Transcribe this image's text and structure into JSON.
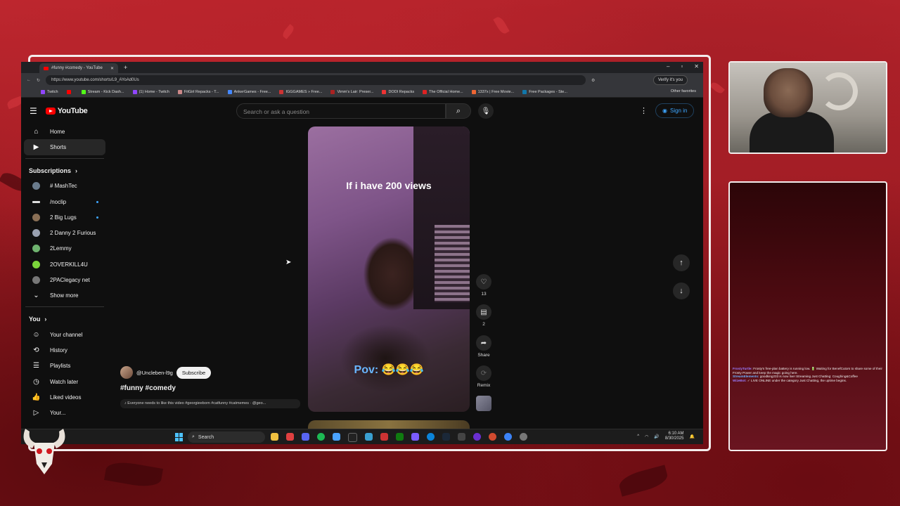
{
  "browser": {
    "tab_title": "#funny #comedy - YouTube",
    "url": "https://www.youtube.com/shorts/L9_AYoAd0Us",
    "verify_label": "Verify it's you",
    "bookmarks": [
      "Twitch",
      "",
      "Stream - Kick Dash...",
      "(1) Home - Twitch",
      "FitGirl Repacks - T...",
      "AnkerGames - Free...",
      "IGGGAMES » Free...",
      "Vimm's Lair: Preser...",
      "DODI Repacks",
      "The Official Home...",
      "1337x | Free Movie...",
      "Free Packages - Ste..."
    ],
    "other_favorites": "Other favorites"
  },
  "youtube": {
    "logo_text": "YouTube",
    "search_placeholder": "Search or ask a question",
    "sign_in": "Sign in",
    "nav": [
      {
        "label": "Home",
        "icon": "home-icon"
      },
      {
        "label": "Shorts",
        "icon": "shorts-icon"
      }
    ],
    "subscriptions_heading": "Subscriptions",
    "subscriptions": [
      {
        "label": "# MashTec",
        "color": "#6a7b8c",
        "live": false
      },
      {
        "label": "/noclip",
        "color": "#dddddd",
        "live": true
      },
      {
        "label": "2 Big Lugs",
        "color": "#8a6f55",
        "live": true
      },
      {
        "label": "2 Danny 2 Furious",
        "color": "#99a0b0",
        "live": false
      },
      {
        "label": "2Lemmy",
        "color": "#6fb36f",
        "live": false
      },
      {
        "label": "2OVERKILL4U",
        "color": "#7bd43a",
        "live": false
      },
      {
        "label": "2PAClegacy net",
        "color": "#777777",
        "live": false
      }
    ],
    "show_more": "Show more",
    "you_heading": "You",
    "you_items": [
      {
        "label": "Your channel",
        "icon": "person-icon"
      },
      {
        "label": "History",
        "icon": "history-icon"
      },
      {
        "label": "Playlists",
        "icon": "playlists-icon"
      },
      {
        "label": "Watch later",
        "icon": "clock-icon"
      },
      {
        "label": "Liked videos",
        "icon": "thumb-up-icon"
      },
      {
        "label": "Your...",
        "icon": "video-icon"
      }
    ]
  },
  "short": {
    "caption_top": "If i have 200 views",
    "caption_bottom": "Pov: 😂😂😂",
    "channel": "@Uncleben-l9g",
    "subscribe": "Subscribe",
    "title": "#funny #comedy",
    "description": "♪ Everyone needs to like this video #georgieeborn #catfunny #catmemes · @geo...",
    "likes": "13",
    "comments": "2",
    "share": "Share",
    "remix": "Remix"
  },
  "taskbar": {
    "search": "Search",
    "time": "6:10 AM",
    "date": "8/30/2025"
  },
  "chat": [
    {
      "name": "FrostyTurtle:",
      "text": "Frosty's free-plan battery is running low. 🔋 Waiting for BenefCutors to share some of their Frosty Power and keep the magic going here."
    },
    {
      "name": "StreamElements:",
      "text": "goodking233 is now live! Streaming Just Chatting: Coughing&Coffee"
    },
    {
      "name": "WizeBot:",
      "text": "✓ LIVE ONLINE under the category Just Chatting, the uptime begins."
    }
  ]
}
